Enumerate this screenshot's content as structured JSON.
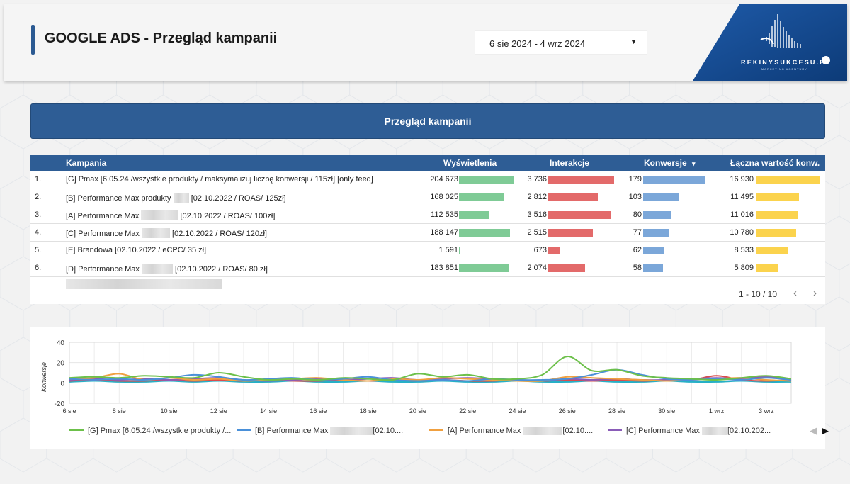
{
  "header": {
    "title": "GOOGLE ADS - Przegląd kampanii",
    "date_range": "6 sie 2024 - 4 wrz 2024",
    "logo_text": "REKINYSUKCESU.PL",
    "logo_subtext": "MARKETING AGENTURY"
  },
  "banner": {
    "title": "Przegląd kampanii"
  },
  "table": {
    "columns": [
      "Kampania",
      "Wyświetlenia",
      "Interakcje",
      "Konwersje",
      "Łączna wartość konw."
    ],
    "sort_indicator": "▾",
    "rows": [
      {
        "index": "1.",
        "pre": "[G] Pmax [6.05.24 /wszystkie produkty / maksymalizuj liczbę konwersji / 115zł] [only feed]",
        "post": "",
        "impressions": "204 673",
        "impressions_v": 204673,
        "interactions": "3 736",
        "interactions_v": 3736,
        "conversions": "179",
        "conversions_v": 179,
        "conv_value": "16 930",
        "conv_value_v": 16930
      },
      {
        "index": "2.",
        "pre": "[B] Performance Max produkty",
        "post": "[02.10.2022 / ROAS/ 125zł]",
        "impressions": "168 025",
        "impressions_v": 168025,
        "interactions": "2 812",
        "interactions_v": 2812,
        "conversions": "103",
        "conversions_v": 103,
        "conv_value": "11 495",
        "conv_value_v": 11495
      },
      {
        "index": "3.",
        "pre": "[A] Performance Max",
        "post": "[02.10.2022 / ROAS/ 100zł]",
        "impressions": "112 535",
        "impressions_v": 112535,
        "interactions": "3 516",
        "interactions_v": 3516,
        "conversions": "80",
        "conversions_v": 80,
        "conv_value": "11 016",
        "conv_value_v": 11016
      },
      {
        "index": "4.",
        "pre": "[C] Performance Max",
        "post": "[02.10.2022 / ROAS/ 120zł]",
        "impressions": "188 147",
        "impressions_v": 188147,
        "interactions": "2 515",
        "interactions_v": 2515,
        "conversions": "77",
        "conversions_v": 77,
        "conv_value": "10 780",
        "conv_value_v": 10780
      },
      {
        "index": "5.",
        "pre": "[E] Brandowa [02.10.2022 / eCPC/ 35 zł]",
        "post": "",
        "impressions": "1 591",
        "impressions_v": 1591,
        "interactions": "673",
        "interactions_v": 673,
        "conversions": "62",
        "conversions_v": 62,
        "conv_value": "8 533",
        "conv_value_v": 8533
      },
      {
        "index": "6.",
        "pre": "[D] Performance Max",
        "post": "[02.10.2022 / ROAS/ 80 zł]",
        "impressions": "183 851",
        "impressions_v": 183851,
        "interactions": "2 074",
        "interactions_v": 2074,
        "conversions": "58",
        "conversions_v": 58,
        "conv_value": "5 809",
        "conv_value_v": 5809
      }
    ],
    "bar_colors": {
      "impressions": "#7fcb96",
      "interactions": "#e36a6a",
      "conversions": "#7ba7d9",
      "conv_value": "#fbd34d"
    },
    "pagination": "1 - 10 / 10"
  },
  "chart_data": {
    "type": "line",
    "x": [
      "6 sie",
      "7 sie",
      "8 sie",
      "9 sie",
      "10 sie",
      "11 sie",
      "12 sie",
      "13 sie",
      "14 sie",
      "15 sie",
      "16 sie",
      "17 sie",
      "18 sie",
      "19 sie",
      "20 sie",
      "21 sie",
      "22 sie",
      "23 sie",
      "24 sie",
      "25 sie",
      "26 sie",
      "27 sie",
      "28 sie",
      "29 sie",
      "30 sie",
      "31 sie",
      "1 wrz",
      "2 wrz",
      "3 wrz",
      "4 wrz"
    ],
    "xticks": [
      "6 sie",
      "8 sie",
      "10 sie",
      "12 sie",
      "14 sie",
      "16 sie",
      "18 sie",
      "20 sie",
      "22 sie",
      "24 sie",
      "26 sie",
      "28 sie",
      "30 sie",
      "1 wrz",
      "3 wrz"
    ],
    "ylabel": "Konwersje",
    "ylim": [
      -20,
      40
    ],
    "yticks": [
      -20,
      0,
      20,
      40
    ],
    "grid": true,
    "legend_position": "bottom",
    "series": [
      {
        "name": "[G] Pmax [6.05.24 /wszystkie produkty /...",
        "color": "#6cc04a",
        "values": [
          5,
          6,
          5,
          7,
          6,
          5,
          10,
          6,
          3,
          4,
          3,
          5,
          4,
          3,
          9,
          6,
          8,
          4,
          4,
          8,
          26,
          12,
          13,
          7,
          5,
          4,
          3,
          5,
          7,
          4
        ]
      },
      {
        "name": "[B] Performance Max",
        "name_suffix": "[02.10....",
        "color": "#4a90d9",
        "values": [
          4,
          3,
          4,
          3,
          5,
          8,
          6,
          3,
          4,
          5,
          3,
          4,
          6,
          3,
          2,
          3,
          2,
          4,
          3,
          3,
          4,
          8,
          13,
          8,
          4,
          3,
          4,
          3,
          5,
          3
        ]
      },
      {
        "name": "[A] Performance Max",
        "name_suffix": "[02.10....",
        "color": "#f0a040",
        "values": [
          4,
          5,
          9,
          3,
          5,
          3,
          4,
          2,
          3,
          4,
          5,
          3,
          2,
          4,
          3,
          5,
          4,
          3,
          2,
          2,
          6,
          5,
          4,
          3,
          2,
          3,
          4,
          5,
          3,
          2
        ]
      },
      {
        "name": "[C] Performance Max",
        "name_suffix": "[02.10.202...",
        "color": "#8a5cb8",
        "values": [
          3,
          4,
          3,
          4,
          3,
          4,
          5,
          3,
          2,
          3,
          4,
          3,
          4,
          5,
          3,
          4,
          5,
          4,
          3,
          2,
          4,
          3,
          4,
          3,
          3,
          4,
          5,
          4,
          6,
          4
        ]
      },
      {
        "name": "[E] Brandowa",
        "color": "#d94c4c",
        "values": [
          2,
          3,
          2,
          2,
          3,
          2,
          3,
          2,
          3,
          2,
          2,
          3,
          2,
          3,
          2,
          3,
          2,
          2,
          3,
          2,
          3,
          2,
          3,
          2,
          3,
          3,
          7,
          3,
          2,
          3
        ]
      },
      {
        "name": "[D] Performance Max",
        "color": "#26b0c6",
        "values": [
          1,
          2,
          1,
          1,
          2,
          1,
          2,
          1,
          1,
          2,
          1,
          1,
          2,
          1,
          1,
          2,
          1,
          1,
          2,
          1,
          1,
          2,
          1,
          1,
          2,
          1,
          1,
          2,
          1,
          1
        ]
      }
    ]
  }
}
